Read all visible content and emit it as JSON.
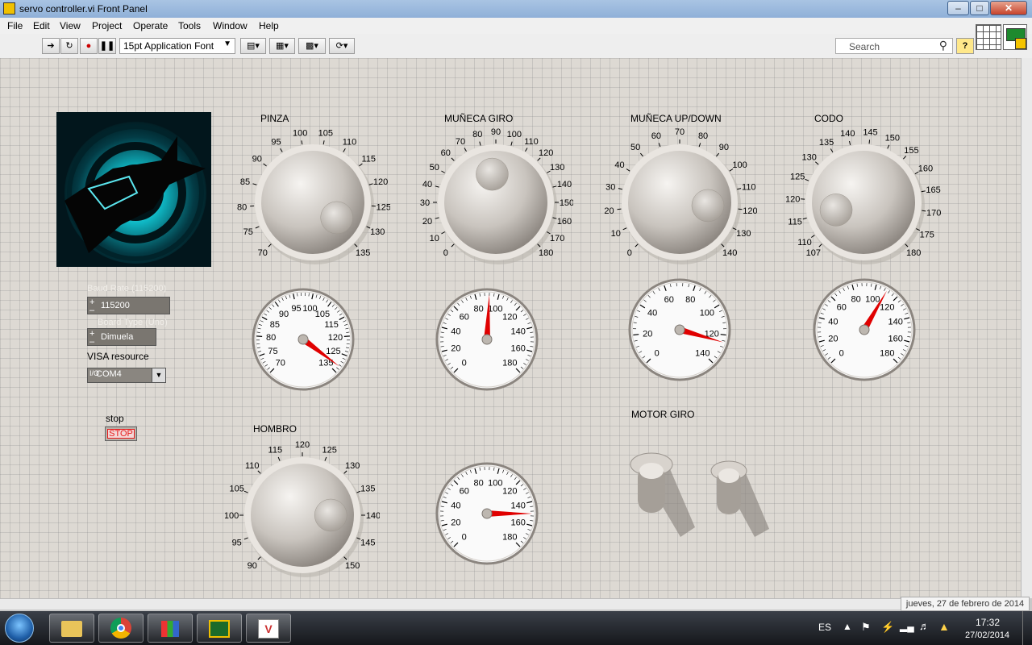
{
  "window": {
    "title": "servo controller.vi Front Panel"
  },
  "menu": [
    "File",
    "Edit",
    "View",
    "Project",
    "Operate",
    "Tools",
    "Window",
    "Help"
  ],
  "toolbar": {
    "font_label": "15pt Application Font",
    "search_placeholder": "Search"
  },
  "controls": {
    "baud": {
      "label": "Baud Rate (115200)",
      "value": "115200"
    },
    "board": {
      "label": "Board Type (Uno)",
      "value": "Dimuela"
    },
    "visa": {
      "label": "VISA resource",
      "value": "COM4"
    },
    "stop": {
      "label": "stop",
      "button": "STOP"
    },
    "motor": {
      "label": "MOTOR GIRO"
    }
  },
  "knobs": [
    {
      "id": "pinza",
      "label": "PINZA",
      "ticks": [
        70,
        75,
        80,
        85,
        90,
        95,
        100,
        105,
        110,
        115,
        120,
        125,
        130,
        135
      ],
      "value": 132
    },
    {
      "id": "muneca-giro",
      "label": "MUÑECA GIRO",
      "ticks": [
        0,
        10,
        20,
        30,
        40,
        50,
        60,
        70,
        80,
        90,
        100,
        110,
        120,
        130,
        140,
        150,
        160,
        170,
        180
      ],
      "value": 85
    },
    {
      "id": "muneca-updown",
      "label": "MUÑECA UP/DOWN",
      "ticks": [
        0,
        10,
        20,
        30,
        40,
        50,
        60,
        70,
        80,
        90,
        100,
        110,
        120,
        130,
        140
      ],
      "value": 120
    },
    {
      "id": "codo",
      "label": "CODO",
      "ticks": [
        107,
        110,
        115,
        120,
        125,
        130,
        135,
        140,
        145,
        150,
        155,
        160,
        165,
        170,
        175,
        180
      ],
      "value": 115
    },
    {
      "id": "hombro",
      "label": "HOMBRO",
      "ticks": [
        90,
        95,
        100,
        105,
        110,
        115,
        120,
        125,
        130,
        135,
        140,
        145,
        150
      ],
      "value": 140
    }
  ],
  "gauges": [
    {
      "id": "g-pinza",
      "ticks": [
        70,
        75,
        80,
        85,
        90,
        95,
        100,
        105,
        115,
        120,
        125,
        135
      ],
      "value": 133
    },
    {
      "id": "g-muneca-giro",
      "ticks": [
        0,
        20,
        40,
        60,
        80,
        100,
        120,
        140,
        160,
        180
      ],
      "value": 92
    },
    {
      "id": "g-muneca-updown",
      "ticks": [
        0,
        20,
        40,
        60,
        80,
        100,
        120,
        140
      ],
      "value": 125
    },
    {
      "id": "g-codo",
      "ticks": [
        0,
        20,
        40,
        60,
        80,
        100,
        120,
        140,
        160,
        180
      ],
      "value": 110
    },
    {
      "id": "g-hombro",
      "ticks": [
        0,
        20,
        40,
        60,
        80,
        100,
        120,
        140,
        160,
        180
      ],
      "value": 150
    }
  ],
  "status": {
    "date": "jueves, 27 de febrero de 2014"
  },
  "tray": {
    "lang": "ES",
    "time": "17:32",
    "date": "27/02/2014"
  },
  "colors": {
    "panel": "#ddd9d3",
    "needle": "#e00000",
    "stop": "#e81b1b"
  }
}
